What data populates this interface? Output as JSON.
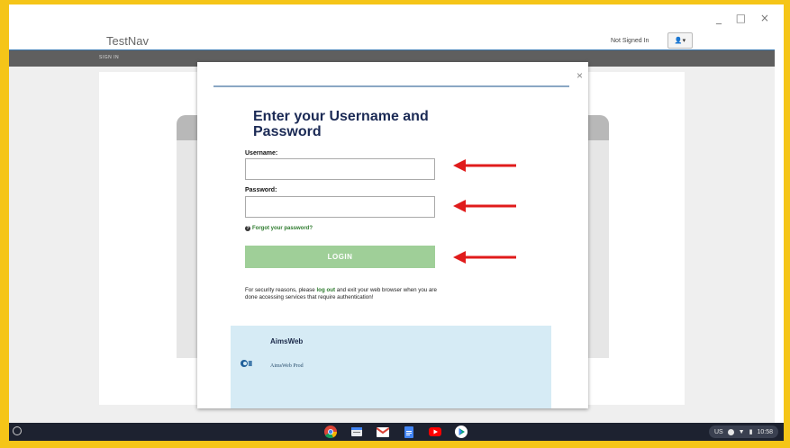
{
  "window": {
    "controls": "_ □ ×",
    "title": "TestNav"
  },
  "header": {
    "signin_status": "Not Signed In",
    "user_menu": "👤▾"
  },
  "navbar": {
    "label": "SIGN IN"
  },
  "modal": {
    "close": "×",
    "heading": "Enter your Username and Password",
    "username_label": "Username:",
    "username_value": "",
    "password_label": "Password:",
    "password_value": "",
    "forgot_link": "Forgot your password?",
    "login_button": "LOGIN",
    "notice_pre": "For security reasons, please ",
    "notice_link": "log out",
    "notice_post": " and exit your web browser when you are done accessing services that require authentication!",
    "app_name": "AimsWeb",
    "app_sub": "AimsWeb Prod"
  },
  "taskbar": {
    "locale": "US",
    "time": "10:58",
    "apps": [
      "chrome-icon",
      "files-icon",
      "gmail-icon",
      "docs-icon",
      "youtube-icon",
      "play-store-icon"
    ]
  },
  "colors": {
    "frame": "#f5c518",
    "heading": "#1b2a55",
    "login_button": "#9fcf98",
    "arrow": "#e01b1b",
    "navbar": "#5f5f5f"
  }
}
